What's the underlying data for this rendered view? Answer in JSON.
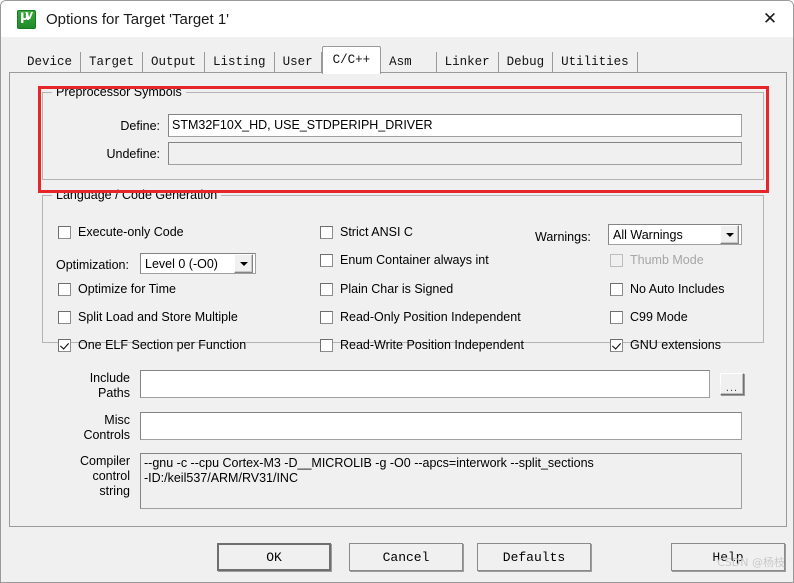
{
  "window": {
    "title": "Options for Target 'Target 1'",
    "app_icon": "uvision-icon",
    "close_icon": "close-icon"
  },
  "tabs": [
    {
      "label": "Device",
      "active": false
    },
    {
      "label": "Target",
      "active": false
    },
    {
      "label": "Output",
      "active": false
    },
    {
      "label": "Listing",
      "active": false
    },
    {
      "label": "User",
      "active": false
    },
    {
      "label": "C/C++",
      "active": true
    },
    {
      "label": "Asm",
      "active": false
    },
    {
      "label": "Linker",
      "active": false
    },
    {
      "label": "Debug",
      "active": false
    },
    {
      "label": "Utilities",
      "active": false
    }
  ],
  "preprocessor": {
    "group_title": "Preprocessor Symbols",
    "define_label": "Define:",
    "define_value": "STM32F10X_HD, USE_STDPERIPH_DRIVER",
    "undefine_label": "Undefine:",
    "undefine_value": ""
  },
  "language": {
    "group_title": "Language / Code Generation",
    "optimization_label": "Optimization:",
    "optimization_value": "Level 0 (-O0)",
    "warnings_label": "Warnings:",
    "warnings_value": "All Warnings",
    "col1": [
      {
        "label": "Execute-only Code",
        "checked": false,
        "disabled": false
      },
      {
        "label": "Optimize for Time",
        "checked": false,
        "disabled": false
      },
      {
        "label": "Split Load and Store Multiple",
        "checked": false,
        "disabled": false
      },
      {
        "label": "One ELF Section per Function",
        "checked": true,
        "disabled": false
      }
    ],
    "col2": [
      {
        "label": "Strict ANSI C",
        "checked": false,
        "disabled": false
      },
      {
        "label": "Enum Container always int",
        "checked": false,
        "disabled": false
      },
      {
        "label": "Plain Char is Signed",
        "checked": false,
        "disabled": false
      },
      {
        "label": "Read-Only Position Independent",
        "checked": false,
        "disabled": false
      },
      {
        "label": "Read-Write Position Independent",
        "checked": false,
        "disabled": false
      }
    ],
    "col3": [
      {
        "label": "Thumb Mode",
        "checked": false,
        "disabled": true
      },
      {
        "label": "No Auto Includes",
        "checked": false,
        "disabled": false
      },
      {
        "label": "C99 Mode",
        "checked": false,
        "disabled": false
      },
      {
        "label": "GNU extensions",
        "checked": true,
        "disabled": false
      }
    ]
  },
  "fields": {
    "include_paths_label": "Include\nPaths",
    "include_paths_value": "",
    "misc_controls_label": "Misc\nControls",
    "misc_controls_value": "",
    "compiler_string_label": "Compiler\ncontrol\nstring",
    "compiler_string_value": "--gnu -c --cpu Cortex-M3 -D__MICROLIB -g -O0 --apcs=interwork --split_sections\n-ID:/keil537/ARM/RV31/INC",
    "browse_label": "..."
  },
  "buttons": {
    "ok": "OK",
    "cancel": "Cancel",
    "defaults": "Defaults",
    "help": "Help"
  },
  "annotation": {
    "highlight_color": "#e8262a"
  },
  "watermark": "CSDN @杨枝"
}
